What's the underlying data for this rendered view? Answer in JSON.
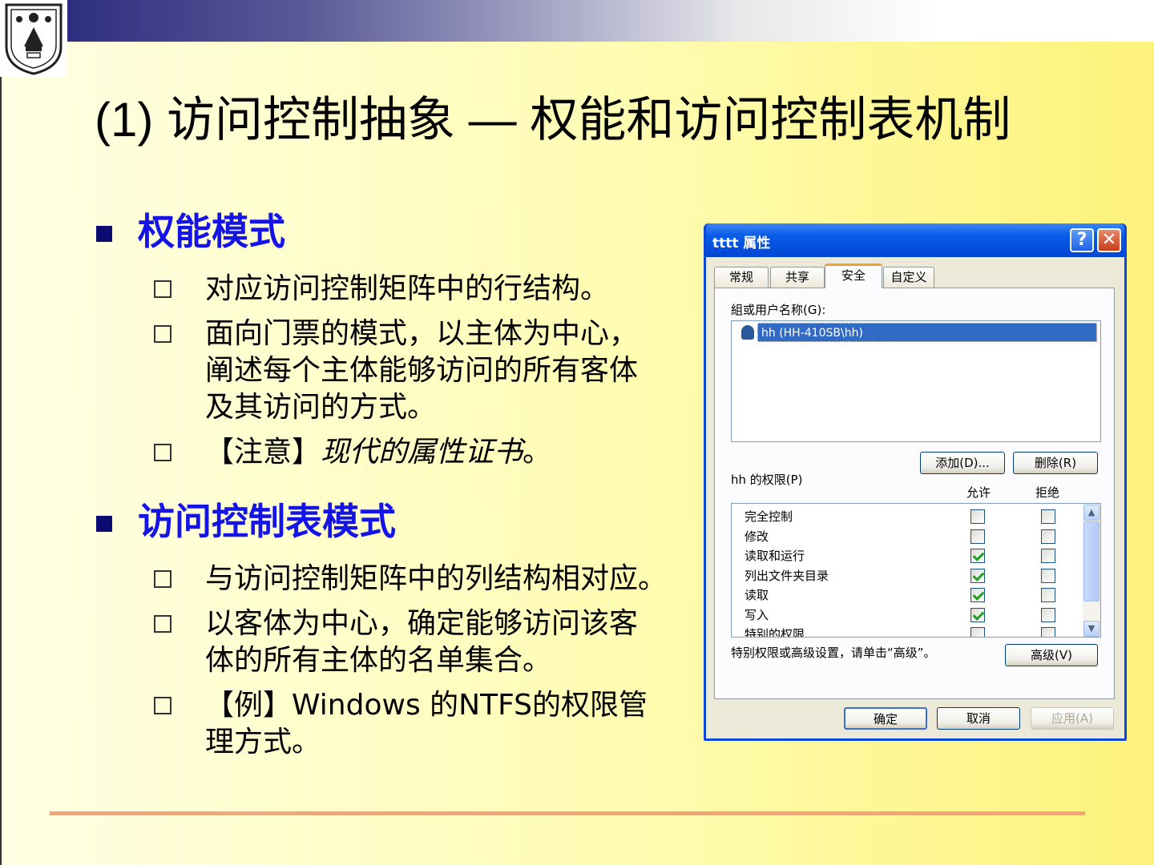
{
  "slide": {
    "title": "(1) 访问控制抽象 — 权能和访问控制表机制",
    "sections": [
      {
        "heading": "权能模式",
        "items": [
          {
            "lines": [
              "对应访问控制矩阵中的行结构。"
            ]
          },
          {
            "lines": [
              "面向门票的模式，以主体为中心，",
              "阐述每个主体能够访问的所有客体",
              "及其访问的方式。"
            ]
          },
          {
            "prefix": "【注意】",
            "italic": "现代的属性证书",
            "suffix": "。"
          }
        ]
      },
      {
        "heading": "访问控制表模式",
        "items": [
          {
            "lines": [
              "与访问控制矩阵中的列结构相对应。"
            ]
          },
          {
            "lines": [
              "以客体为中心，确定能够访问该客",
              "体的所有主体的名单集合。"
            ]
          },
          {
            "lines": [
              "【例】Windows 的NTFS的权限管",
              "理方式。"
            ]
          }
        ]
      }
    ]
  },
  "dialog": {
    "title": "tttt 属性",
    "help": "?",
    "close": "✕",
    "tabs": [
      "常规",
      "共享",
      "安全",
      "自定义"
    ],
    "active_tab": "安全",
    "group_label": "組或用户名称(G):",
    "user": "hh (HH-410SB\\hh)",
    "add_button": "添加(D)...",
    "remove_button": "删除(R)",
    "perm_label": "hh 的权限(P)",
    "allow": "允许",
    "deny": "拒绝",
    "permissions": [
      {
        "name": "完全控制",
        "allow": false,
        "deny": false
      },
      {
        "name": "修改",
        "allow": false,
        "deny": false
      },
      {
        "name": "读取和运行",
        "allow": true,
        "deny": false
      },
      {
        "name": "列出文件夹目录",
        "allow": true,
        "deny": false
      },
      {
        "name": "读取",
        "allow": true,
        "deny": false
      },
      {
        "name": "写入",
        "allow": true,
        "deny": false
      },
      {
        "name": "特别的权限",
        "allow": false,
        "deny": false
      }
    ],
    "advanced_hint": "特别权限或高级设置，请单击“高级”。",
    "advanced_button": "高级(V)",
    "ok": "确定",
    "cancel": "取消",
    "apply": "应用(A)",
    "scroll_up": "▲",
    "scroll_down": "▼"
  },
  "colors": {
    "heading": "#1414e6",
    "bullet": "#0c0c70",
    "rule": "#f4a478"
  }
}
